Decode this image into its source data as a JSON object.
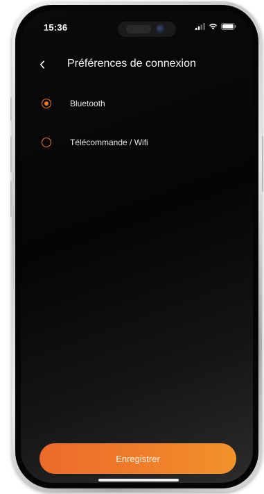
{
  "status_bar": {
    "time": "15:36",
    "icons": [
      "signal-icon",
      "wifi-icon",
      "battery-icon"
    ]
  },
  "header": {
    "back_icon": "chevron-left-icon",
    "title": "Préférences de connexion"
  },
  "options": [
    {
      "label": "Bluetooth",
      "selected": true
    },
    {
      "label": "Télécommande / Wifi",
      "selected": false
    }
  ],
  "save_button": {
    "label": "Enregistrer"
  },
  "colors": {
    "accent": "#f07a2a",
    "button_gradient_start": "#ec6a2c",
    "button_gradient_end": "#f3922a",
    "background": "#050505",
    "text": "#f5f5f5"
  }
}
